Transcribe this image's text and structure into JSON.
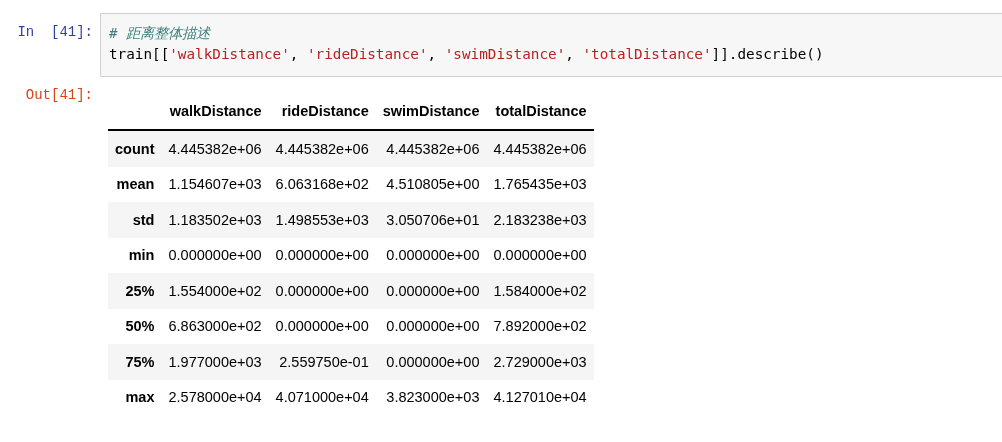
{
  "input_prompt": "In  [41]:",
  "code_lines": [
    [
      {
        "kind": "comment",
        "text": "# 距离整体描述"
      }
    ],
    [
      {
        "kind": "plain",
        "text": "train[["
      },
      {
        "kind": "string",
        "text": "'walkDistance'"
      },
      {
        "kind": "plain",
        "text": ", "
      },
      {
        "kind": "string",
        "text": "'rideDistance'"
      },
      {
        "kind": "plain",
        "text": ", "
      },
      {
        "kind": "string",
        "text": "'swimDistance'"
      },
      {
        "kind": "plain",
        "text": ", "
      },
      {
        "kind": "string",
        "text": "'totalDistance'"
      },
      {
        "kind": "plain",
        "text": "]].describe()"
      }
    ]
  ],
  "output_prompt": "Out[41]:",
  "table": {
    "columns": [
      "walkDistance",
      "rideDistance",
      "swimDistance",
      "totalDistance"
    ],
    "rows": [
      {
        "label": "count",
        "cells": [
          "4.445382e+06",
          "4.445382e+06",
          "4.445382e+06",
          "4.445382e+06"
        ]
      },
      {
        "label": "mean",
        "cells": [
          "1.154607e+03",
          "6.063168e+02",
          "4.510805e+00",
          "1.765435e+03"
        ]
      },
      {
        "label": "std",
        "cells": [
          "1.183502e+03",
          "1.498553e+03",
          "3.050706e+01",
          "2.183238e+03"
        ]
      },
      {
        "label": "min",
        "cells": [
          "0.000000e+00",
          "0.000000e+00",
          "0.000000e+00",
          "0.000000e+00"
        ]
      },
      {
        "label": "25%",
        "cells": [
          "1.554000e+02",
          "0.000000e+00",
          "0.000000e+00",
          "1.584000e+02"
        ]
      },
      {
        "label": "50%",
        "cells": [
          "6.863000e+02",
          "0.000000e+00",
          "0.000000e+00",
          "7.892000e+02"
        ]
      },
      {
        "label": "75%",
        "cells": [
          "1.977000e+03",
          "2.559750e-01",
          "0.000000e+00",
          "2.729000e+03"
        ]
      },
      {
        "label": "max",
        "cells": [
          "2.578000e+04",
          "4.071000e+04",
          "3.823000e+03",
          "4.127010e+04"
        ]
      }
    ]
  }
}
